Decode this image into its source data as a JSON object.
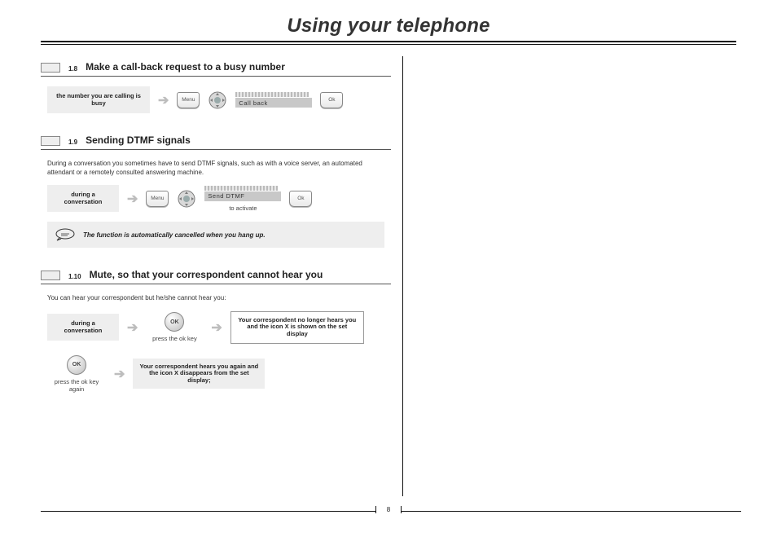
{
  "header": {
    "title": "Using your telephone"
  },
  "sections": {
    "s18": {
      "num": "1.8",
      "title": "Make a call-back request to a busy number",
      "state": "the number you are calling is busy",
      "key_menu": "Menu",
      "softkey": "Call back",
      "key_ok": "Ok"
    },
    "s19": {
      "num": "1.9",
      "title": "Sending DTMF signals",
      "intro": "During a conversation you sometimes have to send DTMF signals, such as with a voice server, an automated attendant or a remotely consulted answering machine.",
      "state": "during a conversation",
      "key_menu": "Menu",
      "softkey": "Send DTMF",
      "key_ok": "Ok",
      "sublabel": "to activate",
      "note": "The function is automatically cancelled when you hang up."
    },
    "s110": {
      "num": "1.10",
      "title": "Mute, so that your correspondent cannot hear you",
      "intro": "You can hear your correspondent but he/she cannot hear you:",
      "state": "during a conversation",
      "ok_label": "OK",
      "ok_caption1": "press the ok key",
      "result1": "Your correspondent no longer hears you and the icon X is shown on the set display",
      "ok_caption2": "press the ok key again",
      "result2": "Your correspondent hears you again and the icon X disappears from the set display;"
    }
  },
  "page_number": "8"
}
